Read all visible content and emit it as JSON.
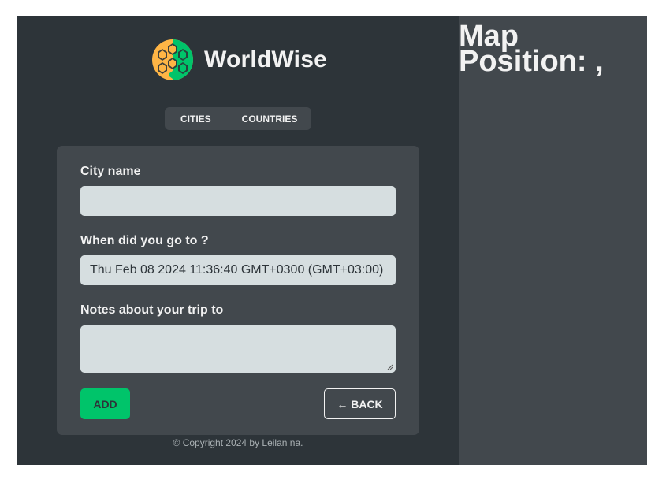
{
  "brand": {
    "name": "WorldWise"
  },
  "nav": {
    "items": [
      {
        "label": "Cities"
      },
      {
        "label": "Countries"
      }
    ]
  },
  "form": {
    "city_label": "City name",
    "city_value": "",
    "date_label": "When did you go to ?",
    "date_value": "Thu Feb 08 2024 11:36:40 GMT+0300 (GMT+03:00)",
    "notes_label": "Notes about your trip to",
    "notes_value": "",
    "add_label": "Add",
    "back_label": "← Back"
  },
  "footer": {
    "copyright": "© Copyright 2024 by Leilan na."
  },
  "map": {
    "title": "Map",
    "position_label": "Position: ,"
  },
  "colors": {
    "sidebar": "#2d3439",
    "panel": "#42484d",
    "field": "#d6dee0",
    "accent": "#00c46a",
    "text": "#f2f2f2"
  }
}
